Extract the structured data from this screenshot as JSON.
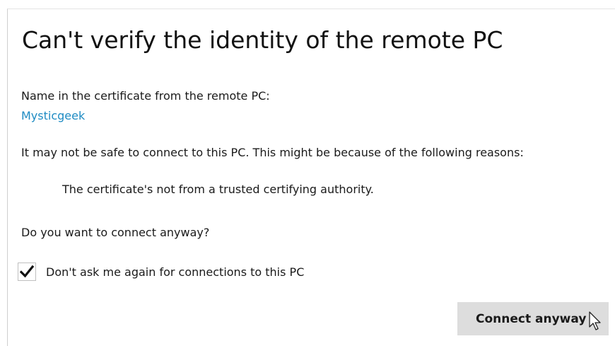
{
  "dialog": {
    "title": "Can't verify the identity of the remote PC",
    "cert_label": "Name in the certificate from the remote PC:",
    "cert_name": "Mysticgeek",
    "warning": "It may not be safe to connect to this PC. This might be because of the following reasons:",
    "reason": "The certificate's not from a trusted certifying authority.",
    "question": "Do you want to connect anyway?",
    "checkbox": {
      "label": "Don't ask me again for connections to this PC",
      "checked": true
    },
    "connect_button": "Connect anyway"
  },
  "colors": {
    "accent_link": "#1e8bc3",
    "button_bg": "#dddddd"
  },
  "icons": {
    "checkbox": "checkmark-icon",
    "cursor": "mouse-pointer-icon"
  }
}
